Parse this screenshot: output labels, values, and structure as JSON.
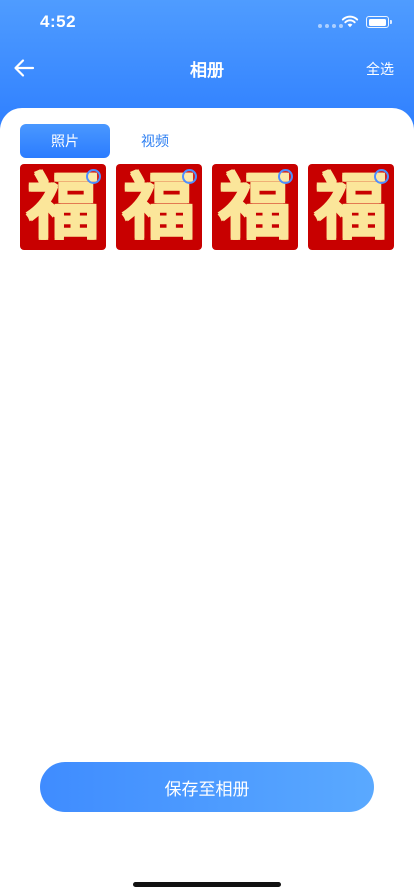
{
  "status_bar": {
    "time": "4:52"
  },
  "header": {
    "title": "相册",
    "select_all_label": "全选",
    "back_icon": "arrow-left-icon"
  },
  "tabs": [
    {
      "label": "照片",
      "active": true
    },
    {
      "label": "视频",
      "active": false
    }
  ],
  "photos": [
    {
      "char": "福",
      "selected": false
    },
    {
      "char": "福",
      "selected": false
    },
    {
      "char": "福",
      "selected": false
    },
    {
      "char": "福",
      "selected": false
    }
  ],
  "footer": {
    "save_label": "保存至相册"
  },
  "colors": {
    "accent": "#2a7bff",
    "photo_background": "#c80000",
    "photo_glyph": "#fbe69a"
  }
}
